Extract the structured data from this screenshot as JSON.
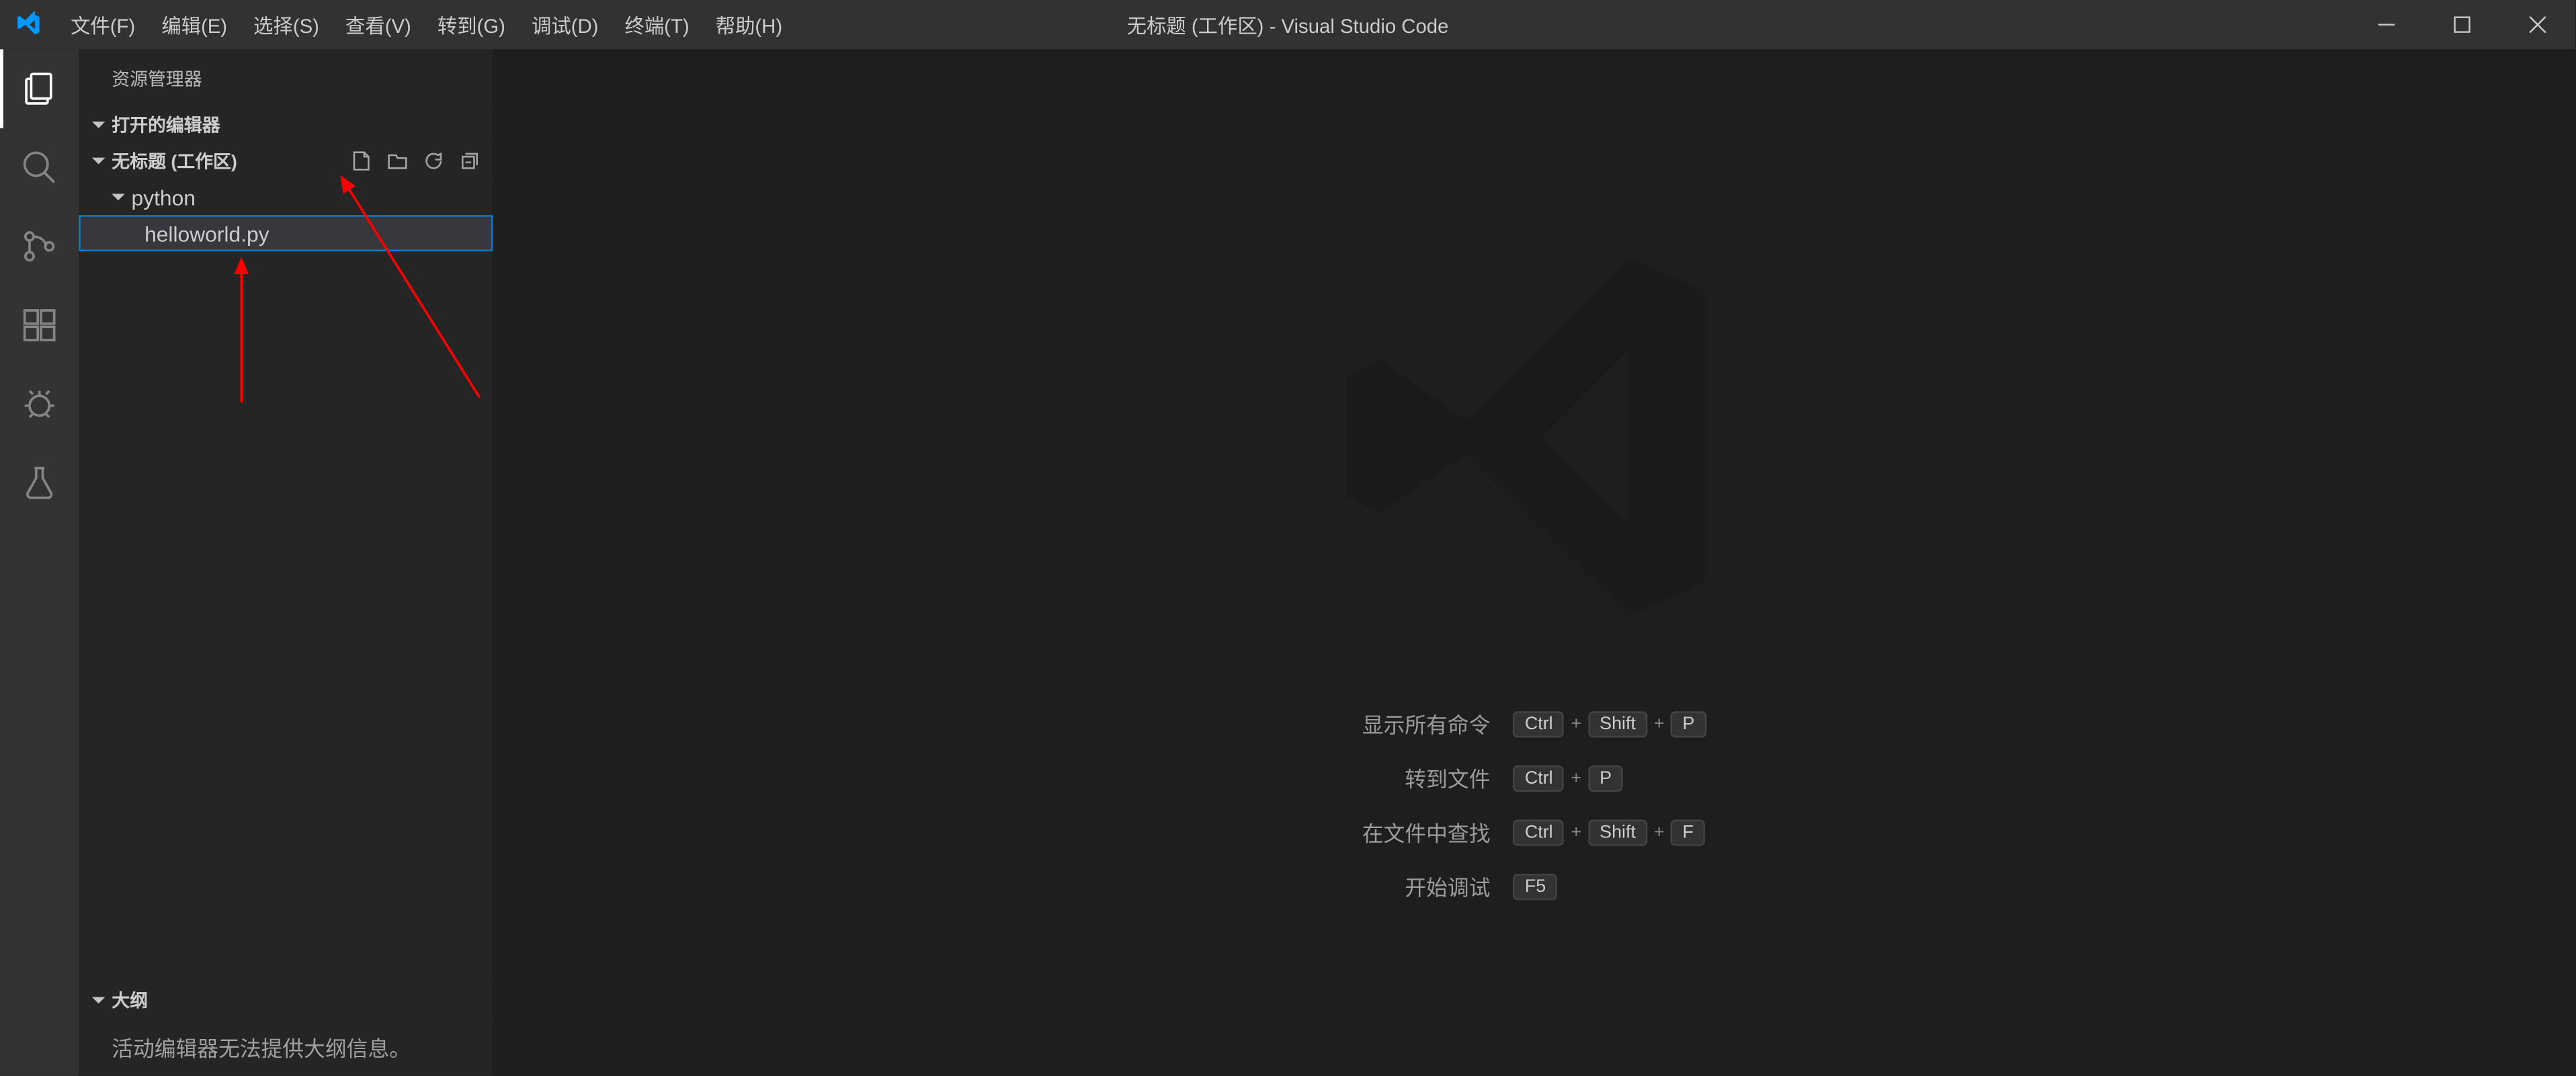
{
  "titlebar": {
    "menus": [
      "文件(F)",
      "编辑(E)",
      "选择(S)",
      "查看(V)",
      "转到(G)",
      "调试(D)",
      "终端(T)",
      "帮助(H)"
    ],
    "title": "无标题 (工作区) - Visual Studio Code"
  },
  "activity": {
    "items": [
      {
        "name": "explorer-icon",
        "active": true
      },
      {
        "name": "search-icon",
        "active": false
      },
      {
        "name": "source-control-icon",
        "active": false
      },
      {
        "name": "extensions-icon",
        "active": false
      },
      {
        "name": "debug-bug-icon",
        "active": false
      },
      {
        "name": "test-icon",
        "active": false
      }
    ]
  },
  "sidebar": {
    "title": "资源管理器",
    "sections": {
      "open_editors": "打开的编辑器",
      "workspace": "无标题 (工作区)",
      "outline": "大纲"
    },
    "tree": {
      "folder": "python",
      "file": "helloworld.py"
    },
    "outline_message": "活动编辑器无法提供大纲信息。"
  },
  "welcome": {
    "shortcuts": [
      {
        "label": "显示所有命令",
        "keys": [
          "Ctrl",
          "Shift",
          "P"
        ]
      },
      {
        "label": "转到文件",
        "keys": [
          "Ctrl",
          "P"
        ]
      },
      {
        "label": "在文件中查找",
        "keys": [
          "Ctrl",
          "Shift",
          "F"
        ]
      },
      {
        "label": "开始调试",
        "keys": [
          "F5"
        ]
      }
    ]
  }
}
